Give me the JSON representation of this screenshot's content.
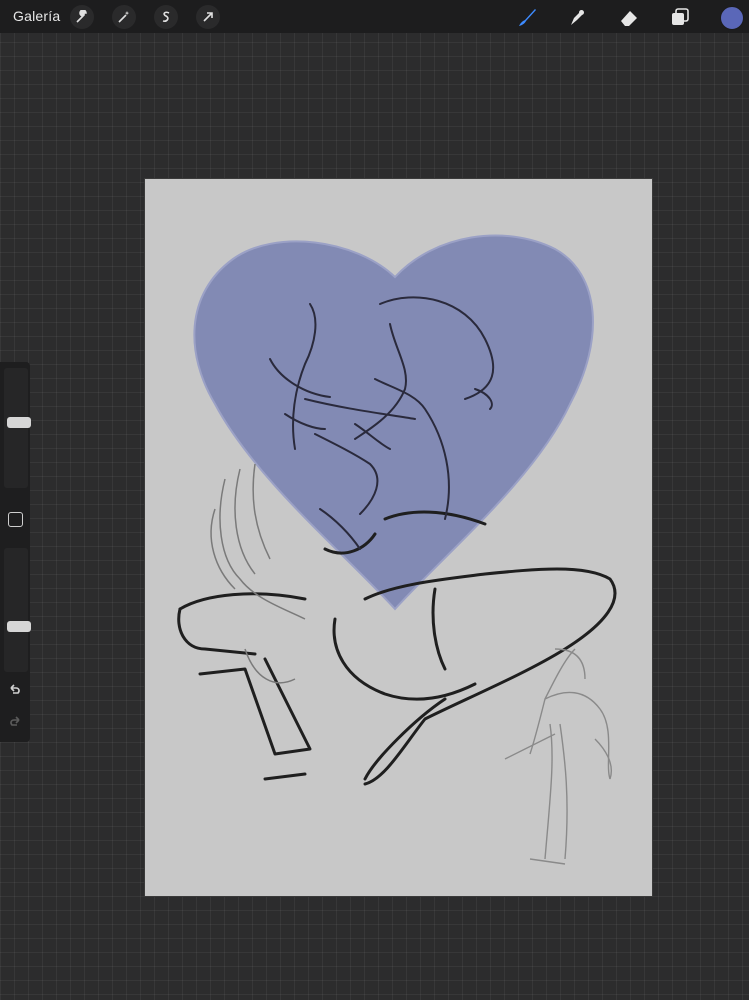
{
  "topbar": {
    "gallery_label": "Galería",
    "left_tools": [
      "wrench-icon",
      "magic-wand-icon",
      "selection-icon",
      "transform-arrow-icon"
    ],
    "right_tools": [
      "brush-icon",
      "smudge-icon",
      "eraser-icon",
      "layers-icon"
    ],
    "active_tool": "brush-icon",
    "accent_color": "#3d8bff",
    "current_color": "#5a67b8"
  },
  "sidebar": {
    "brush_size_level": 0.55,
    "opacity_level": 0.35,
    "modify_button": "square-modify-icon",
    "undo": "undo-icon",
    "redo": "redo-icon"
  },
  "canvas": {
    "background": "#c8c8c8",
    "heart_fill": "#8088b4",
    "line_color": "#222222"
  }
}
